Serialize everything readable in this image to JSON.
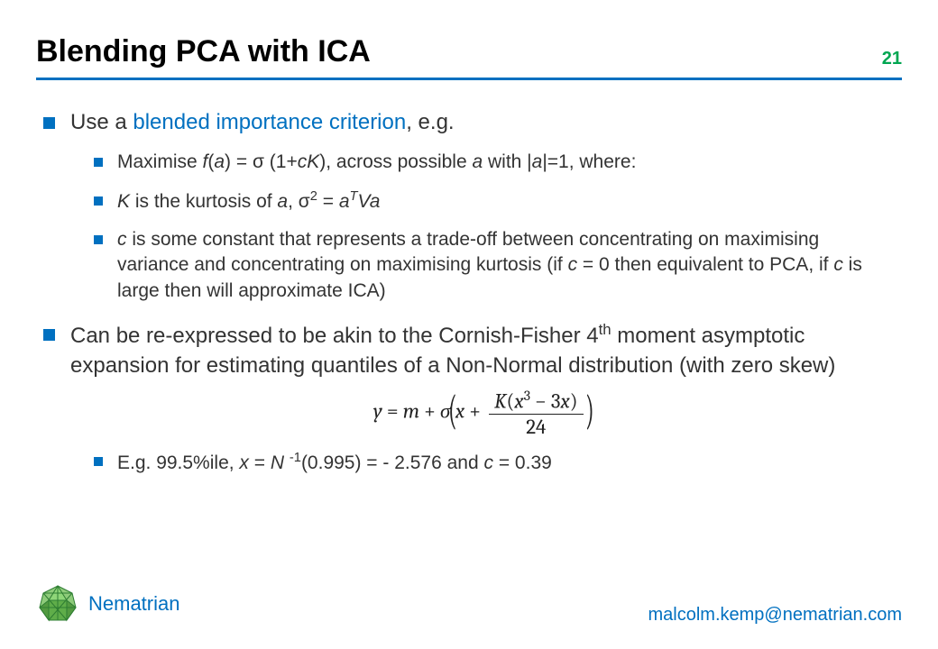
{
  "header": {
    "title": "Blending PCA with ICA",
    "page_number": "21"
  },
  "bullets": {
    "b1_prefix": "Use a ",
    "b1_highlight": "blended importance criterion",
    "b1_suffix": ", e.g.",
    "b1a_p1": "Maximise ",
    "b1a_f": "f",
    "b1a_p2": "(",
    "b1a_a1": "a",
    "b1a_p3": ") = σ (1+",
    "b1a_cK": "cK",
    "b1a_p4": "), across possible ",
    "b1a_a2": "a",
    "b1a_p5": " with |",
    "b1a_a3": "a",
    "b1a_p6": "|=1, where:",
    "b1b_K": "K",
    "b1b_p1": " is the kurtosis of ",
    "b1b_a": "a",
    "b1b_p2": ", σ",
    "b1b_sup2": "2",
    "b1b_p3": " = ",
    "b1b_a2": "a",
    "b1b_supT": "T",
    "b1b_Va": "Va",
    "b1c_c": "c",
    "b1c_p1": " is some constant that represents a trade-off between concentrating on maximising variance and concentrating on maximising kurtosis (if ",
    "b1c_c2": "c",
    "b1c_p2": " = 0 then equivalent to PCA, if ",
    "b1c_c3": "c",
    "b1c_p3": " is large then will approximate ICA)",
    "b2_p1": "Can be re-expressed to be akin to the Cornish-Fisher 4",
    "b2_th": "th",
    "b2_p2": " moment asymptotic expansion for estimating quantiles of a Non-Normal distribution (with zero skew)",
    "b2a_p1": "E.g. 99.5%ile, ",
    "b2a_x": "x",
    "b2a_p2": " = ",
    "b2a_N": "N",
    "b2a_p3": " ",
    "b2a_supneg1": "-1",
    "b2a_p4": "(0.995) = - 2.576 and ",
    "b2a_c": "c",
    "b2a_p5": " = 0.39"
  },
  "formula": {
    "y": "y",
    "eq": " = ",
    "m": "m",
    "plus1": " + ",
    "sigma": "σ",
    "lparen": "(",
    "x": "x",
    "plus2": " + ",
    "num_K": "K",
    "num_open": "(",
    "num_x": "x",
    "num_cubed": "3",
    "num_minus": " − 3",
    "num_x2": "x",
    "num_close": ")",
    "den": "24",
    "rparen": ")"
  },
  "footer": {
    "brand": "Nematrian",
    "email": "malcolm.kemp@nematrian.com"
  }
}
